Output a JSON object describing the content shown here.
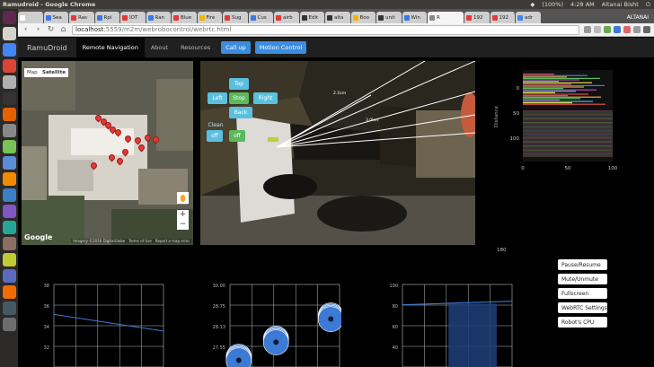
{
  "os": {
    "window_title": "Ramudroid - Google Chrome",
    "battery": "(100%)",
    "time": "4:28 AM",
    "user": "Altanai Bisht"
  },
  "launcher": {
    "icons": [
      {
        "name": "dash-icon",
        "color": "#5e2750"
      },
      {
        "name": "files-icon",
        "color": "#d6d3cf"
      },
      {
        "name": "chrome-icon",
        "color": "#4285f4"
      },
      {
        "name": "gmail-icon",
        "color": "#db4437"
      },
      {
        "name": "mail-icon",
        "color": "#b0b0b0"
      },
      {
        "name": "terminal-icon",
        "color": "#333333"
      },
      {
        "name": "firefox-icon",
        "color": "#e66000"
      },
      {
        "name": "settings-icon",
        "color": "#888888"
      },
      {
        "name": "android-icon",
        "color": "#78c257"
      },
      {
        "name": "editor-icon",
        "color": "#5a8dd6"
      },
      {
        "name": "vlc-icon",
        "color": "#f18a00"
      },
      {
        "name": "office-icon",
        "color": "#3b7fc4"
      },
      {
        "name": "app-icon",
        "color": "#7e57c2"
      },
      {
        "name": "app2-icon",
        "color": "#26a69a"
      },
      {
        "name": "app3-icon",
        "color": "#8d6e63"
      },
      {
        "name": "app4-icon",
        "color": "#c0ca33"
      },
      {
        "name": "app5-icon",
        "color": "#5c6bc0"
      },
      {
        "name": "app6-icon",
        "color": "#ef6c00"
      },
      {
        "name": "app7-icon",
        "color": "#455a64"
      },
      {
        "name": "trash-icon",
        "color": "#6d6d6d"
      }
    ]
  },
  "tabs": {
    "owner": "ALTANAI",
    "items": [
      {
        "label": "",
        "color": "#ffffff"
      },
      {
        "label": "Sea",
        "color": "#3b78e7"
      },
      {
        "label": "Ras",
        "color": "#e53935"
      },
      {
        "label": "Rpi",
        "color": "#3b78e7"
      },
      {
        "label": "IOT",
        "color": "#e53935"
      },
      {
        "label": "Ran",
        "color": "#3b78e7"
      },
      {
        "label": "Blue",
        "color": "#e53935"
      },
      {
        "label": "Fire",
        "color": "#f4b400"
      },
      {
        "label": "Sug",
        "color": "#e53935"
      },
      {
        "label": "Cus",
        "color": "#3b78e7"
      },
      {
        "label": "airb",
        "color": "#e53935"
      },
      {
        "label": "Edit",
        "color": "#333333"
      },
      {
        "label": "alta",
        "color": "#333333"
      },
      {
        "label": "Boo",
        "color": "#f4b400"
      },
      {
        "label": "unit",
        "color": "#333333"
      },
      {
        "label": "Win",
        "color": "#3b78e7"
      },
      {
        "label": "R",
        "color": "#888888",
        "active": true
      },
      {
        "label": "192",
        "color": "#e53935"
      },
      {
        "label": "192",
        "color": "#e53935"
      },
      {
        "label": "adr",
        "color": "#4285f4"
      }
    ]
  },
  "toolbar": {
    "url_host": "localhost",
    "url_path": ":5559/m2m/webrobocontrol/webrtc.html"
  },
  "navbar": {
    "brand": "RamuDroid",
    "links": [
      "Remote Navigation",
      "About",
      "Resources"
    ],
    "call_up": "Call up",
    "motion_control": "Motion Control"
  },
  "map": {
    "map_label": "Map",
    "satellite_label": "Satellite",
    "zoom_in": "+",
    "zoom_out": "−",
    "logo": "Google",
    "footer": [
      "Imagery ©2016 DigitalGlobe",
      "Terms of Use",
      "Report a map error"
    ]
  },
  "video": {
    "top": "Top",
    "left": "Left",
    "stop": "Stop",
    "right": "Right",
    "back": "Back",
    "clean": "Clean",
    "off1": "off",
    "off2": "off",
    "scan_labels": [
      "2.1km",
      "3.0km"
    ]
  },
  "lidar": {
    "y_axis_title": "Distance",
    "y_ticks": [
      "0",
      "50",
      "100"
    ],
    "x_ticks": [
      "0",
      "50",
      "100"
    ]
  },
  "chart_data": [
    {
      "type": "line",
      "y_ticks": [
        "38",
        "36",
        "34",
        "32"
      ],
      "series": [
        {
          "x": [
            0,
            1
          ],
          "y": [
            35.9,
            34.5
          ]
        }
      ],
      "ylim": [
        31.5,
        38.4
      ],
      "color": "#3c7ad6"
    },
    {
      "type": "scatter",
      "y_ticks": [
        "30.00",
        "28.75",
        "28.13",
        "27.55"
      ],
      "points": [
        {
          "x": 0.08,
          "y": 27.3
        },
        {
          "x": 0.42,
          "y": 28.0
        },
        {
          "x": 0.92,
          "y": 28.9
        }
      ],
      "ylim": [
        26.9,
        30.1
      ],
      "color": "#3c7ad6"
    },
    {
      "type": "area",
      "y_ticks": [
        "100",
        "80",
        "60",
        "40"
      ],
      "series": [
        {
          "x": [
            0,
            1
          ],
          "y": [
            85,
            88
          ]
        }
      ],
      "ylim": [
        33,
        102
      ],
      "color": "#1f3f7a"
    }
  ],
  "side_label": "180",
  "controls": {
    "buttons": [
      "Pause/Resume",
      "Mute/Unmute",
      "Fullscreen",
      "WebRTC Settings",
      "Robot's CPU"
    ]
  }
}
